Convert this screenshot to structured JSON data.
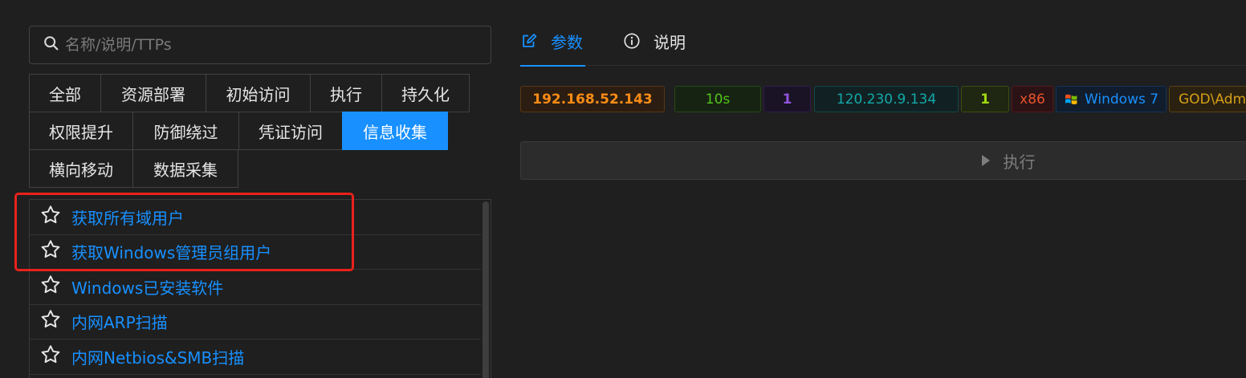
{
  "search": {
    "placeholder": "名称/说明/TTPs",
    "value": ""
  },
  "categories": [
    {
      "label": "全部",
      "active": false
    },
    {
      "label": "资源部署",
      "active": false
    },
    {
      "label": "初始访问",
      "active": false
    },
    {
      "label": "执行",
      "active": false
    },
    {
      "label": "持久化",
      "active": false
    },
    {
      "label": "权限提升",
      "active": false
    },
    {
      "label": "防御绕过",
      "active": false
    },
    {
      "label": "凭证访问",
      "active": false
    },
    {
      "label": "信息收集",
      "active": true
    },
    {
      "label": "横向移动",
      "active": false
    },
    {
      "label": "数据采集",
      "active": false
    }
  ],
  "modules": [
    {
      "label": "获取所有域用户",
      "icon": "star-icon"
    },
    {
      "label": "获取Windows管理员组用户",
      "icon": "star-icon"
    },
    {
      "label": "Windows已安装软件",
      "icon": "star-icon"
    },
    {
      "label": "内网ARP扫描",
      "icon": "star-icon"
    },
    {
      "label": "内网Netbios&SMB扫描",
      "icon": "star-icon"
    }
  ],
  "tabs": [
    {
      "label": "参数",
      "icon": "edit-icon",
      "active": true
    },
    {
      "label": "说明",
      "icon": "info-circle-icon",
      "active": false
    }
  ],
  "session_info": {
    "internal_ip": "192.168.52.143",
    "interval": "10s",
    "pid_count": "1",
    "external_ip": "120.230.9.134",
    "integrity": "1",
    "arch": "x86",
    "os": "Windows 7",
    "user": "GOD\\Administrator"
  },
  "colors": {
    "accent": "#1890ff",
    "highlight_box": "#e8221b",
    "internal_ip": "#fa8c16",
    "interval": "#52c41a",
    "pid_count": "#9254de",
    "external_ip": "#13a8a8",
    "integrity": "#a0d911",
    "arch": "#e8542c",
    "os": "#1890ff",
    "user": "#d4a017"
  },
  "actions": {
    "execute_label": "执行"
  }
}
